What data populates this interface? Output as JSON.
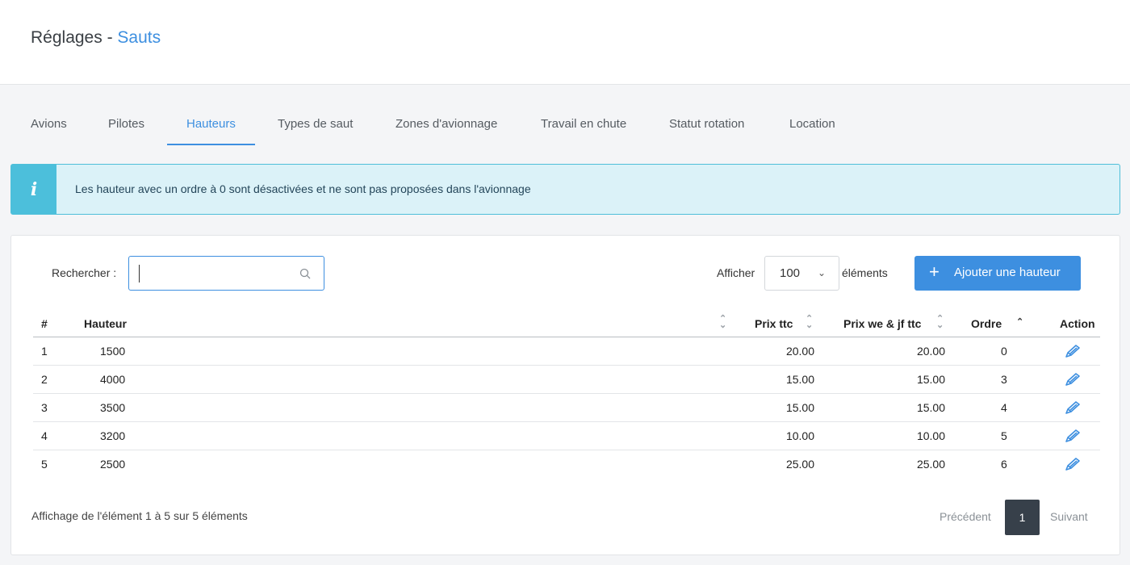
{
  "header": {
    "title_prefix": "Réglages",
    "title_separator": " - ",
    "title_section": "Sauts"
  },
  "tabs": [
    {
      "label": "Avions",
      "active": false
    },
    {
      "label": "Pilotes",
      "active": false
    },
    {
      "label": "Hauteurs",
      "active": true
    },
    {
      "label": "Types de saut",
      "active": false
    },
    {
      "label": "Zones d'avionnage",
      "active": false
    },
    {
      "label": "Travail en chute",
      "active": false
    },
    {
      "label": "Statut rotation",
      "active": false
    },
    {
      "label": "Location",
      "active": false
    }
  ],
  "alert": {
    "icon": "info-icon",
    "icon_glyph": "i",
    "text": "Les hauteur avec un ordre à 0 sont désactivées et ne sont pas proposées dans l'avionnage"
  },
  "toolbar": {
    "search_label": "Rechercher :",
    "search_value": "",
    "show_label": "Afficher",
    "page_size": "100",
    "items_label": "éléments",
    "add_label": "Ajouter une hauteur"
  },
  "table": {
    "headers": {
      "num": "#",
      "height": "Hauteur",
      "price": "Prix ttc",
      "price_we": "Prix we & jf ttc",
      "order": "Ordre",
      "action": "Action"
    },
    "rows": [
      {
        "num": "1",
        "height": "1500",
        "price": "20.00",
        "price_we": "20.00",
        "order": "0"
      },
      {
        "num": "2",
        "height": "4000",
        "price": "15.00",
        "price_we": "15.00",
        "order": "3"
      },
      {
        "num": "3",
        "height": "3500",
        "price": "15.00",
        "price_we": "15.00",
        "order": "4"
      },
      {
        "num": "4",
        "height": "3200",
        "price": "10.00",
        "price_we": "10.00",
        "order": "5"
      },
      {
        "num": "5",
        "height": "2500",
        "price": "25.00",
        "price_we": "25.00",
        "order": "6"
      }
    ]
  },
  "footer": {
    "info": "Affichage de l'élément 1 à 5 sur 5 éléments",
    "prev": "Précédent",
    "current_page": "1",
    "next": "Suivant"
  },
  "colors": {
    "accent": "#3d8fe0",
    "info": "#4cbfdb",
    "pager_active": "#37404a"
  }
}
